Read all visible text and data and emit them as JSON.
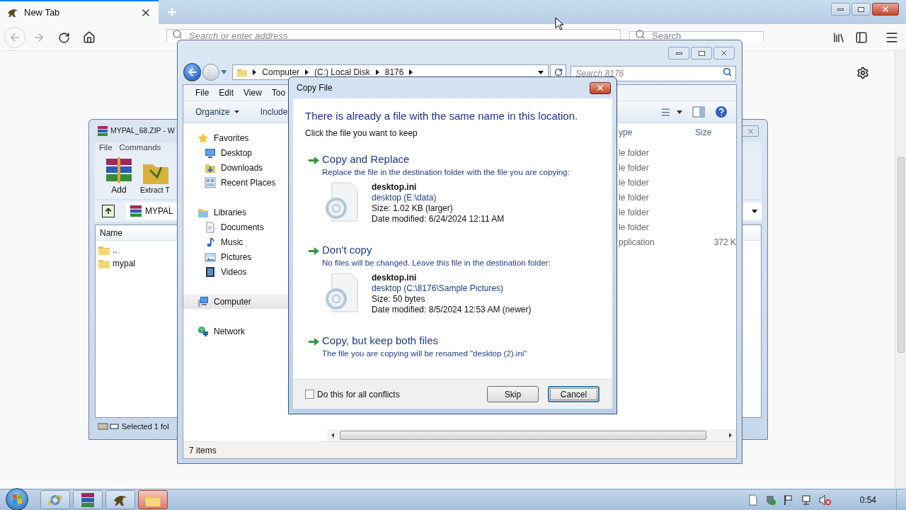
{
  "browser": {
    "tab": {
      "title": "New Tab",
      "selected": true
    },
    "address": {
      "placeholder": "Search or enter address"
    },
    "search": {
      "placeholder": "Search"
    }
  },
  "winrar": {
    "title": "MYPAL_68.ZIP - W",
    "menu": [
      "File",
      "Commands"
    ],
    "tools": [
      "Add",
      "Extract T"
    ],
    "path": "MYPAL",
    "column": "Name",
    "rows": [
      {
        "name": ".."
      },
      {
        "name": "mypal"
      }
    ],
    "status": "Selected 1 fol"
  },
  "explorer": {
    "breadcrumb": [
      "Computer",
      "(C:) Local Disk",
      "8176"
    ],
    "search": {
      "placeholder": "Search 8176"
    },
    "menu": [
      "File",
      "Edit",
      "View",
      "Too"
    ],
    "toolbar": [
      "Organize",
      "Include"
    ],
    "nav": [
      {
        "label": "Favorites",
        "kind": "star",
        "selected": false,
        "children": [
          {
            "label": "Desktop",
            "kind": "desktop",
            "selected": false
          },
          {
            "label": "Downloads",
            "kind": "downloads",
            "selected": false
          },
          {
            "label": "Recent Places",
            "kind": "recent",
            "selected": false
          }
        ]
      },
      {
        "label": "Libraries",
        "kind": "library",
        "selected": false,
        "children": [
          {
            "label": "Documents",
            "kind": "documents",
            "selected": false
          },
          {
            "label": "Music",
            "kind": "music",
            "selected": false
          },
          {
            "label": "Pictures",
            "kind": "pictures",
            "selected": false
          },
          {
            "label": "Videos",
            "kind": "videos",
            "selected": false
          }
        ]
      },
      {
        "label": "Computer",
        "kind": "computer",
        "selected": true
      },
      {
        "label": "Network",
        "kind": "network",
        "selected": false
      }
    ],
    "columns": [
      "ype",
      "Size"
    ],
    "rows": [
      {
        "cells": [
          "le folder"
        ]
      },
      {
        "cells": [
          "le folder"
        ]
      },
      {
        "cells": [
          "le folder"
        ]
      },
      {
        "cells": [
          "le folder"
        ]
      },
      {
        "cells": [
          "le folder"
        ]
      },
      {
        "cells": [
          "le folder"
        ]
      },
      {
        "cells": [
          "pplication",
          "372 K"
        ]
      }
    ],
    "status": "7 items"
  },
  "dialog": {
    "title": "Copy File",
    "heading": "There is already a file with the same name in this location.",
    "subtitle": "Click the file you want to keep",
    "options": [
      {
        "title": "Copy and Replace",
        "description": "Replace the file in the destination folder with the file you are copying:",
        "file": {
          "name": "desktop.ini",
          "location": "desktop (E:\\data)",
          "size": "Size: 1.02 KB (larger)",
          "modified": "Date modified: 6/24/2024 12:11 AM"
        }
      },
      {
        "title": "Don't copy",
        "description": "No files will be changed. Leave this file in the destination folder:",
        "file": {
          "name": "desktop.ini",
          "location": "desktop (C:\\8176\\Sample Pictures)",
          "size": "Size: 50 bytes",
          "modified": "Date modified: 8/5/2024 12:53 AM (newer)"
        }
      },
      {
        "title": "Copy, but keep both files",
        "description": "The file you are copying will be renamed \"desktop (2).ini\""
      }
    ],
    "checkbox": {
      "label": "Do this for all conflicts",
      "checked": false
    },
    "buttons": [
      {
        "label": "Skip",
        "default": false
      },
      {
        "label": "Cancel",
        "default": true
      }
    ]
  },
  "taskbar": {
    "apps": [
      {
        "kind": "ie",
        "active": false
      },
      {
        "kind": "winrar",
        "active": false
      },
      {
        "kind": "mypal",
        "active": false
      },
      {
        "kind": "explorer",
        "active": true
      }
    ],
    "clock": "0:54"
  }
}
